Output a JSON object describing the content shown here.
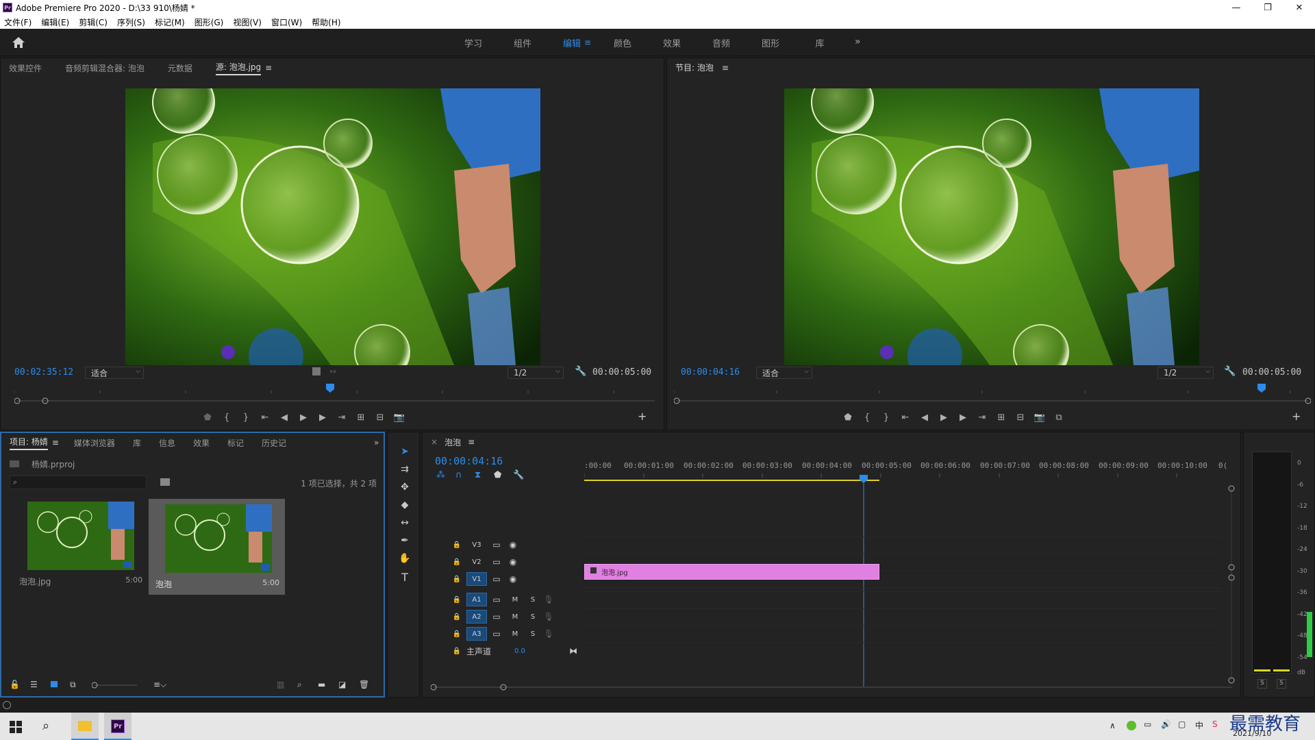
{
  "window": {
    "title": "Adobe Premiere Pro 2020 - D:\\33 910\\杨婧 *",
    "controls": [
      "—",
      "❐",
      "✕"
    ]
  },
  "menu": [
    "文件(F)",
    "编辑(E)",
    "剪辑(C)",
    "序列(S)",
    "标记(M)",
    "图形(G)",
    "视图(V)",
    "窗口(W)",
    "帮助(H)"
  ],
  "workspaces": {
    "tabs": [
      "学习",
      "组件",
      "编辑",
      "颜色",
      "效果",
      "音频",
      "图形",
      "库"
    ],
    "active": "编辑",
    "more": "»"
  },
  "source": {
    "tabs": [
      "效果控件",
      "音频剪辑混合器: 泡泡",
      "元数据",
      "源: 泡泡.jpg"
    ],
    "active_tab": "源: 泡泡.jpg",
    "timecode": "00:02:35:12",
    "fit": "适合",
    "resolution": "1/2",
    "duration": "00:00:05:00"
  },
  "program": {
    "title": "节目: 泡泡",
    "timecode": "00:00:04:16",
    "fit": "适合",
    "resolution": "1/2",
    "duration": "00:00:05:00"
  },
  "project": {
    "tabs": [
      "项目: 杨婧",
      "媒体浏览器",
      "库",
      "信息",
      "效果",
      "标记",
      "历史记"
    ],
    "file": "杨婧.prproj",
    "selection": "1 项已选择，共 2 项",
    "items": [
      {
        "name": "泡泡.jpg",
        "duration": "5:00"
      },
      {
        "name": "泡泡",
        "duration": "5:00"
      }
    ]
  },
  "timeline": {
    "sequence": "泡泡",
    "timecode": "00:00:04:16",
    "ruler": [
      ":00:00",
      "00:00:01:00",
      "00:00:02:00",
      "00:00:03:00",
      "00:00:04:00",
      "00:00:05:00",
      "00:00:06:00",
      "00:00:07:00",
      "00:00:08:00",
      "00:00:09:00",
      "00:00:10:00",
      "0("
    ],
    "video_tracks": [
      "V3",
      "V2",
      "V1"
    ],
    "audio_tracks": [
      "A1",
      "A2",
      "A3"
    ],
    "track_m": "M",
    "track_s": "S",
    "master_label": "主声道",
    "master_value": "0.0",
    "clip_name": "泡泡.jpg",
    "clip_color": "#e080e0"
  },
  "meter": {
    "scale": [
      "0",
      "-6",
      "-12",
      "-18",
      "-24",
      "-30",
      "-36",
      "-42",
      "-48",
      "-54",
      "dB"
    ],
    "solo": [
      "S",
      "S"
    ]
  },
  "tray": {
    "ime": "中",
    "date": "2021/9/10",
    "watermark": "最需教育"
  }
}
